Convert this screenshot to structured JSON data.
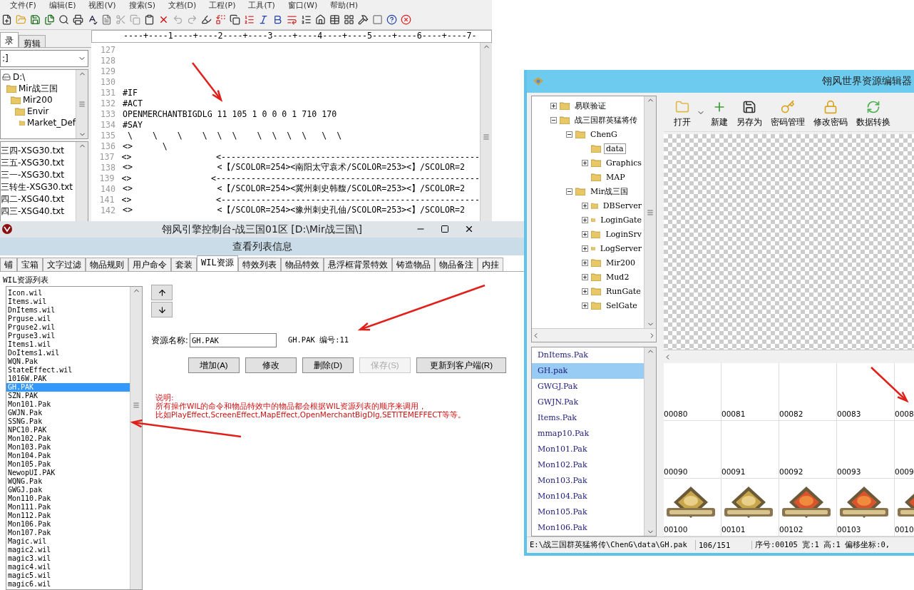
{
  "editor": {
    "menu": [
      "文件(F)",
      "编辑(E)",
      "视图(V)",
      "搜索(S)",
      "文档(D)",
      "工程(P)",
      "工具(T)",
      "窗口(W)",
      "帮助(H)"
    ],
    "left_tabs": [
      {
        "label": "录",
        "selected": true
      },
      {
        "label": "剪辑",
        "selected": false
      }
    ],
    "drive_select": ":]",
    "folder_tree": [
      {
        "label": "D:\\",
        "children": [
          {
            "label": "Mir战三国",
            "children": [
              {
                "label": "Mir200",
                "children": [
                  {
                    "label": "Envir",
                    "children": [
                      {
                        "label": "Market_Def"
                      }
                    ]
                  }
                ]
              }
            ]
          }
        ]
      }
    ],
    "files": [
      "三四-XSG30.txt",
      "三五-XSG30.txt",
      "三一-XSG30.txt",
      "三转生-XSG30.txt",
      "四二-XSG40.txt",
      "四三-XSG40.txt"
    ],
    "ruler": "----+----1----+----2----+----3----+----4----+----5----+----6----+----7-",
    "lines": [
      {
        "number": "127"
      },
      {
        "number": "128"
      },
      {
        "number": "129"
      },
      {
        "number": "130"
      },
      {
        "number": "131",
        "text": "#IF"
      },
      {
        "number": "132",
        "text": "#ACT"
      },
      {
        "number": "133",
        "text": "OPENMERCHANTBIGDLG 11 105 1 0 0 0 1 710 170"
      },
      {
        "number": "134",
        "text": "#SAY"
      },
      {
        "number": "135",
        "text": " \\    \\    \\    \\  \\  \\    \\  \\  \\  \\   \\  \\"
      },
      {
        "number": "136",
        "text": "<>      \\"
      },
      {
        "number": "137",
        "text": "<>                 <----------------------------------------------------"
      },
      {
        "number": "138",
        "text": "<>                 <【/SCOLOR=254><南阳太守袁术/SCOLOR=253><】/SCOLOR=2"
      },
      {
        "number": "139",
        "text": "<>                <-----------------------------------------------------"
      },
      {
        "number": "140",
        "text": "<>                 <【/SCOLOR=254><冀州刺史韩馥/SCOLOR=253><】/SCOLOR=2"
      },
      {
        "number": "141",
        "text": "<>                 <----------------------------------------------------"
      },
      {
        "number": "142",
        "text": "<>                 <【/SCOLOR=254><豫州刺史孔伷/SCOLOR=253><】/SCOLOR=2"
      }
    ]
  },
  "console": {
    "title": "翎风引擎控制台-战三国01区 [D:\\Mir战三国\\]",
    "dialog_title": "查看列表信息",
    "tabs": [
      {
        "label": "铺",
        "selected": false
      },
      {
        "label": "宝箱",
        "selected": false
      },
      {
        "label": "文字过滤",
        "selected": false
      },
      {
        "label": "物品规则",
        "selected": false
      },
      {
        "label": "用户命令",
        "selected": false
      },
      {
        "label": "套装",
        "selected": false
      },
      {
        "label": "WIL资源",
        "selected": true
      },
      {
        "label": "特效列表",
        "selected": false
      },
      {
        "label": "物品特效",
        "selected": false
      },
      {
        "label": "悬浮框背景特效",
        "selected": false
      },
      {
        "label": "铸造物品",
        "selected": false
      },
      {
        "label": "物品备注",
        "selected": false
      },
      {
        "label": "内挂",
        "selected": false
      }
    ],
    "list_title": "WIL资源列表",
    "resources": [
      {
        "name": "Icon.wil",
        "selected": false
      },
      {
        "name": "Items.wil",
        "selected": false
      },
      {
        "name": "DnItems.wil",
        "selected": false
      },
      {
        "name": "Prguse.wil",
        "selected": false
      },
      {
        "name": "Prguse2.wil",
        "selected": false
      },
      {
        "name": "Prguse3.wil",
        "selected": false
      },
      {
        "name": "Items1.wil",
        "selected": false
      },
      {
        "name": "DoItems1.wil",
        "selected": false
      },
      {
        "name": "WQN.Pak",
        "selected": false
      },
      {
        "name": "StateEffect.wil",
        "selected": false
      },
      {
        "name": "1016W.PAK",
        "selected": false
      },
      {
        "name": "GH.PAK",
        "selected": true
      },
      {
        "name": "SZN.PAK",
        "selected": false
      },
      {
        "name": "Mon101.Pak",
        "selected": false
      },
      {
        "name": "GWJN.Pak",
        "selected": false
      },
      {
        "name": "SSNG.Pak",
        "selected": false
      },
      {
        "name": "NPC10.PAK",
        "selected": false
      },
      {
        "name": "Mon102.Pak",
        "selected": false
      },
      {
        "name": "Mon103.Pak",
        "selected": false
      },
      {
        "name": "Mon104.Pak",
        "selected": false
      },
      {
        "name": "Mon105.Pak",
        "selected": false
      },
      {
        "name": "NewopUI.PAK",
        "selected": false
      },
      {
        "name": "WQNG.Pak",
        "selected": false
      },
      {
        "name": "GWGJ.pak",
        "selected": false
      },
      {
        "name": "Mon110.Pak",
        "selected": false
      },
      {
        "name": "Mon111.Pak",
        "selected": false
      },
      {
        "name": "Mon112.Pak",
        "selected": false
      },
      {
        "name": "Mon106.Pak",
        "selected": false
      },
      {
        "name": "Mon107.Pak",
        "selected": false
      },
      {
        "name": "Magic.wil",
        "selected": false
      },
      {
        "name": "magic2.wil",
        "selected": false
      },
      {
        "name": "magic3.wil",
        "selected": false
      },
      {
        "name": "magic4.wil",
        "selected": false
      },
      {
        "name": "magic5.wil",
        "selected": false
      },
      {
        "name": "magic6.wil",
        "selected": false
      }
    ],
    "name_label": "资源名称:",
    "name_value": "GH.PAK",
    "info": "GH.PAK 编号:11",
    "buttons": [
      {
        "label": "增加(A)",
        "disabled": false
      },
      {
        "label": "修改",
        "disabled": false
      },
      {
        "label": "删除(D)",
        "disabled": false
      },
      {
        "label": "保存(S)",
        "disabled": true
      },
      {
        "label": "更新到客户端(R)",
        "disabled": false
      }
    ],
    "note_title": "说明:",
    "note_lines": [
      "所有操作WIL的命令和物品特效中的物品都会根据WIL资源列表的顺序来调用，",
      "比如PlayEffect,ScreenEffect,MapEffect,OpenMerchantBigDlg,SETITEMEFFECT等等。"
    ]
  },
  "resource_editor": {
    "title": "翎风世界资源编辑器",
    "tree": [
      {
        "label": "易联验证",
        "expanded": false,
        "selected": false
      },
      {
        "label": "战三国群英猛将传",
        "expanded": true,
        "selected": false,
        "children": [
          {
            "label": "ChenG",
            "expanded": true,
            "selected": false,
            "children": [
              {
                "label": "data",
                "selected": true
              },
              {
                "label": "Graphics",
                "expanded": false,
                "selected": false
              },
              {
                "label": "MAP",
                "selected": false
              }
            ]
          },
          {
            "label": "Mir战三国",
            "expanded": true,
            "selected": false,
            "children": [
              {
                "label": "DBServer",
                "expanded": false,
                "selected": false
              },
              {
                "label": "LoginGate",
                "expanded": false,
                "selected": false
              },
              {
                "label": "LoginSrv",
                "expanded": false,
                "selected": false
              },
              {
                "label": "LogServer",
                "expanded": false,
                "selected": false
              },
              {
                "label": "Mir200",
                "expanded": false,
                "selected": false
              },
              {
                "label": "Mud2",
                "expanded": false,
                "selected": false
              },
              {
                "label": "RunGate",
                "expanded": false,
                "selected": false
              },
              {
                "label": "SelGate",
                "expanded": false,
                "selected": false
              }
            ]
          }
        ]
      }
    ],
    "toolbar": [
      {
        "label": "打开",
        "kind": "open"
      },
      {
        "label": "新建",
        "kind": "new"
      },
      {
        "label": "另存为",
        "kind": "save"
      },
      {
        "label": "密码管理",
        "kind": "key"
      },
      {
        "label": "修改密码",
        "kind": "lock"
      },
      {
        "label": "数据转换",
        "kind": "convert"
      }
    ],
    "files": [
      {
        "name": "DnItems.Pak",
        "selected": false
      },
      {
        "name": "GH.pak",
        "selected": true
      },
      {
        "name": "GWGJ.Pak",
        "selected": false
      },
      {
        "name": "GWJN.Pak",
        "selected": false
      },
      {
        "name": "Items.Pak",
        "selected": false
      },
      {
        "name": "mmap10.Pak",
        "selected": false
      },
      {
        "name": "Mon101.Pak",
        "selected": false
      },
      {
        "name": "Mon102.Pak",
        "selected": false
      },
      {
        "name": "Mon103.Pak",
        "selected": false
      },
      {
        "name": "Mon104.Pak",
        "selected": false
      },
      {
        "name": "Mon105.Pak",
        "selected": false
      },
      {
        "name": "Mon106.Pak",
        "selected": false
      }
    ],
    "grid": [
      [
        {
          "label": "00080",
          "kind": "empty"
        },
        {
          "label": "00081",
          "kind": "empty"
        },
        {
          "label": "00082",
          "kind": "empty"
        },
        {
          "label": "00083",
          "kind": "empty"
        },
        {
          "label": "0008",
          "kind": "empty"
        }
      ],
      [
        {
          "label": "00090",
          "kind": "empty"
        },
        {
          "label": "00091",
          "kind": "empty"
        },
        {
          "label": "00092",
          "kind": "empty"
        },
        {
          "label": "00093",
          "kind": "empty"
        },
        {
          "label": "0009",
          "kind": "empty"
        }
      ],
      [
        {
          "label": "00100",
          "kind": "picture"
        },
        {
          "label": "00101",
          "kind": "picture"
        },
        {
          "label": "00102",
          "kind": "picture"
        },
        {
          "label": "00103",
          "kind": "picture"
        },
        {
          "label": "0010",
          "kind": "picture"
        }
      ]
    ],
    "status": [
      "E:\\战三国群英猛将传\\ChenG\\data\\GH.pak",
      "106/151",
      "序号:00105 宽:1 高:1 偏移坐标:0,"
    ]
  }
}
